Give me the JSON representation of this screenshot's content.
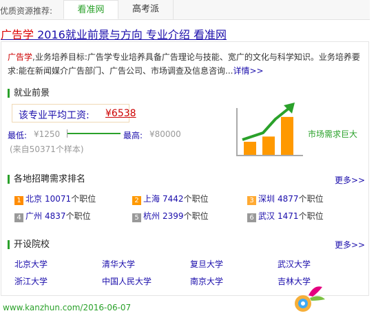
{
  "topbar": {
    "label": "优质资源推荐:",
    "tabs": [
      {
        "label": "看准网"
      },
      {
        "label": "高考派"
      }
    ]
  },
  "title": {
    "keyword": "广告学",
    "rest": " 2016就业前景与方向 专业介绍 看准网"
  },
  "intro": {
    "keyword": "广告学",
    "text": ",业务培养目标:广告学专业培养具备广告理论与技能、宽广的文化与科学知识。业务培养要求:能在新闻媒介广告部门、广告公司、市场调查及信息咨询...",
    "link": "详情>>"
  },
  "employment": {
    "heading": "就业前景",
    "salary_label": "该专业平均工资:",
    "salary_value": "¥6538",
    "min_label": "最低:",
    "min_value": "¥1250",
    "max_label": "最高:",
    "max_value": "¥80000",
    "sample_note": "(来自50371个样本)",
    "demand_label": "市场需求巨大",
    "chart_data": {
      "type": "bar",
      "categories": [
        "1",
        "2",
        "3"
      ],
      "values": [
        1,
        1.4,
        2.9
      ],
      "colors": {
        "bar": "#ff9900",
        "arrow": "#2aa12a",
        "axis": "#aaaaaa"
      }
    }
  },
  "ranking": {
    "heading": "各地招聘需求排名",
    "more": "更多>>",
    "unit": "个职位",
    "cities": [
      {
        "rank": "1",
        "name": "北京",
        "count": "10071",
        "color": "#ff8c00"
      },
      {
        "rank": "2",
        "name": "上海",
        "count": "7442",
        "color": "#ff9900"
      },
      {
        "rank": "3",
        "name": "深圳",
        "count": "4877",
        "color": "#ffaa33"
      },
      {
        "rank": "4",
        "name": "广州",
        "count": "4837",
        "color": "#999999"
      },
      {
        "rank": "5",
        "name": "杭州",
        "count": "2399",
        "color": "#999999"
      },
      {
        "rank": "6",
        "name": "武汉",
        "count": "1471",
        "color": "#999999"
      }
    ]
  },
  "schools": {
    "heading": "开设院校",
    "more": "更多>>",
    "items": [
      "北京大学",
      "清华大学",
      "复旦大学",
      "武汉大学",
      "浙江大学",
      "中国人民大学",
      "南京大学",
      "吉林大学"
    ]
  },
  "footer": {
    "text": "www.kanzhun.com/2016-06-07"
  }
}
